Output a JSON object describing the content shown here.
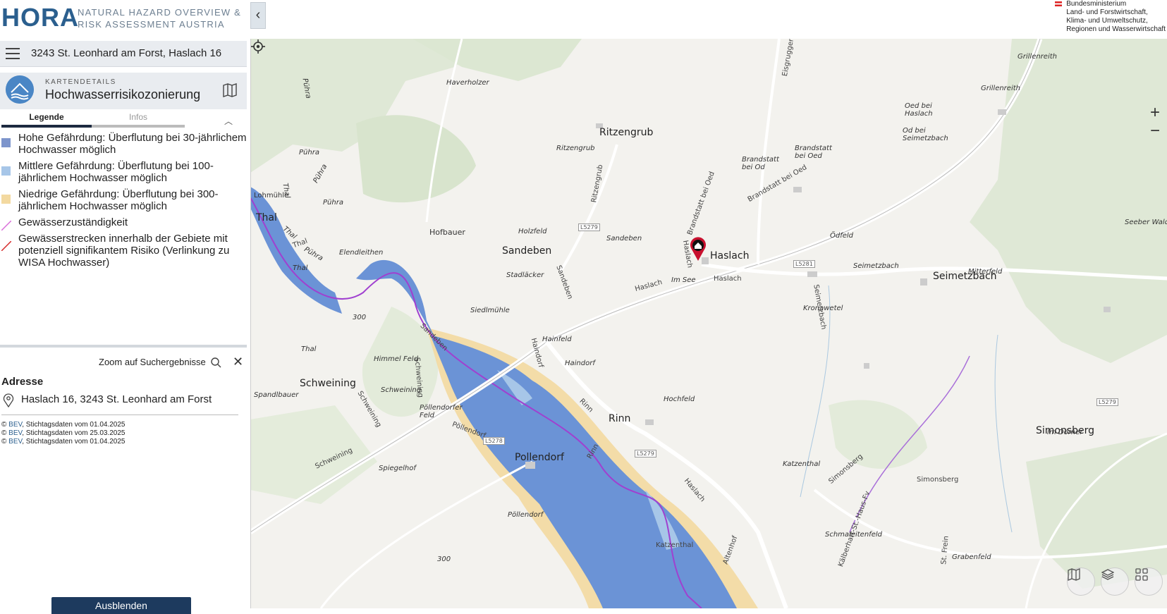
{
  "header": {
    "logo": "HORA",
    "tagline_line1": "NATURAL HAZARD OVERVIEW &",
    "tagline_line2": "RISK ASSESSMENT AUSTRIA",
    "ministry_lines": [
      "Bundesministerium",
      "Land- und Forstwirtschaft,",
      "Klima- und Umweltschutz,",
      "Regionen und Wasserwirtschaft"
    ]
  },
  "search": {
    "value": "3243 St. Leonhard am Forst, Haslach 16"
  },
  "card": {
    "kicker": "KARTENDETAILS",
    "title": "Hochwasserrisikozonierung"
  },
  "tabs": {
    "legende": "Legende",
    "infos": "Infos"
  },
  "legend": {
    "items": [
      {
        "label": "Hohe Gefährdung: Überflutung bei 30-jährlichem Hochwasser möglich",
        "color": "#7d95cc"
      },
      {
        "label": "Mittlere Gefährdung: Überflutung bei 100-jährlichem Hochwasser möglich",
        "color": "#a7c6e8"
      },
      {
        "label": "Niedrige Gefährdung: Überflutung bei 300-jährlichem Hochwasser möglich",
        "color": "#f3d9a0"
      },
      {
        "label": "Gewässerzuständigkeit",
        "color": "#d96fd9"
      },
      {
        "label": "Gewässerstrecken innerhalb der Gebiete mit potenziell signifikantem Risiko (Verlinkung zu WISA Hochwasser)",
        "color": "#d62a2a"
      }
    ]
  },
  "results": {
    "zoom_label": "Zoom auf Suchergebnisse",
    "address_heading": "Adresse",
    "address_value": "Haslach 16, 3243 St. Leonhard am Forst",
    "credits": [
      {
        "source": "BEV",
        "text": ", Stichtagsdaten vom 01.04.2025"
      },
      {
        "source": "BEV",
        "text": ", Stichtagsdaten vom 25.03.2025"
      },
      {
        "source": "BEV",
        "text": ", Stichtagsdaten vom 01.04.2025"
      }
    ]
  },
  "hide_button": "Ausblenden",
  "map": {
    "places": [
      "Ritzengrub",
      "Sandeben",
      "Haslach",
      "Seimetzbach",
      "Schweining",
      "Rinn",
      "Pollendorf",
      "Simonsberg",
      "Thal",
      "Hofbauer"
    ],
    "small_labels": [
      "Haverholzer",
      "Grillenreith",
      "Grillenreith",
      "Oed bei Haslach",
      "Od bei Seimetzbach",
      "Brandstatt bei Oed",
      "Brandstatt bei Od",
      "Ritzengrub",
      "Holzfeld",
      "Sandeben",
      "Stadläcker",
      "Siedlmühle",
      "Elendleithen",
      "Im See",
      "Ödfeld",
      "Seimetzbach",
      "Kronawetel",
      "Mitterfeld",
      "Seeber Wald",
      "Hainfeld",
      "Haindorf",
      "Himmel Feld",
      "Schweining",
      "Pöllendorfer Feld",
      "Spiegelhof",
      "Hochfeld",
      "Katzenthal",
      "Im Dörner",
      "Pöllendorf",
      "Schmaleitenfeld",
      "Grabenfeld",
      "Spandlbauer",
      "Lohmühle",
      "Pühra",
      "Pühra",
      "Pühra",
      "Pühra",
      "Pühra",
      "Thal",
      "Thal",
      "Thal",
      "Thal"
    ],
    "roads": [
      "Brandstatt bei Oed",
      "Haslach",
      "Haslach",
      "Sandeben",
      "Ritzengrub",
      "Eisgruggen",
      "Haindorf",
      "Rinn",
      "Rinn",
      "Schweining",
      "Schweining",
      "Pöllendorf",
      "Simonsberg",
      "Simonsberg",
      "Haslach",
      "Altenhof",
      "Katzenthal",
      "Kälberhart-St.-Haus-Fv",
      "St. Frein",
      "Seimetzbach",
      "Thal",
      "Haslach",
      "Brandstatt bei Oed",
      "Sandeben",
      "Schweining"
    ],
    "route_badges": [
      "L5279",
      "L5281",
      "L5278",
      "L5279",
      "L5279"
    ],
    "contours": [
      "300",
      "300"
    ]
  }
}
